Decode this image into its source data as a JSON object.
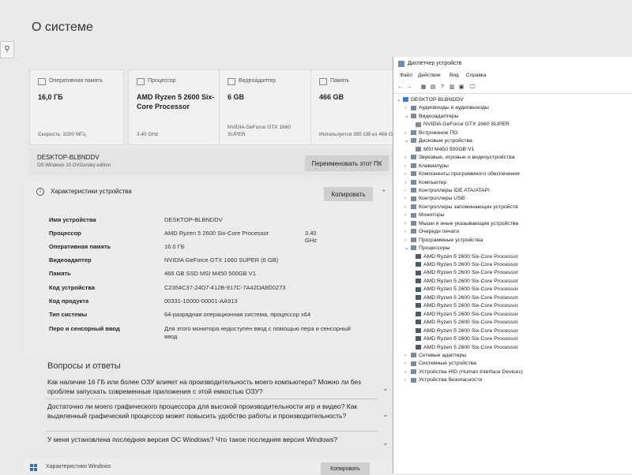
{
  "page": {
    "title": "О системе",
    "search_glyph": "⚲"
  },
  "cards": [
    {
      "label": "Оперативная память",
      "main": "16,0 ГБ",
      "sub": "Скорость: 3200 МГц"
    },
    {
      "label": "Процессор",
      "main": "AMD Ryzen 5 2600 Six-Core Processor",
      "sub": "3.40 GHz"
    },
    {
      "label": "Видеоадаптер",
      "main": "6 GB",
      "sub": "NVIDIA GeForce GTX 1660 SUPER"
    },
    {
      "label": "Память",
      "main": "466 GB",
      "sub": "Используется 395 GB из 466 GB"
    }
  ],
  "device": {
    "name": "DESKTOP-BLBNDDV",
    "os": "OS Windows 10 OVGorskiy edition",
    "rename_label": "Переименовать этот ПК"
  },
  "specs": {
    "title": "Характеристики устройства",
    "copy_label": "Копировать",
    "rows": [
      {
        "k": "Имя устройства",
        "v": "DESKTOP-BLBNDDV",
        "v2": ""
      },
      {
        "k": "Процессор",
        "v": "AMD Ryzen 5 2600 Six-Core Processor",
        "v2": "3.40 GHz"
      },
      {
        "k": "Оперативная память",
        "v": "16.0 ГБ",
        "v2": ""
      },
      {
        "k": "Видеоадаптер",
        "v": "NVIDIA GeForce GTX 1660 SUPER (6 GB)",
        "v2": ""
      },
      {
        "k": "Память",
        "v": "466 GB SSD MSI M450 500GB V1",
        "v2": ""
      },
      {
        "k": "Код устройства",
        "v": "C2354C37-24D7-412B-917C-7A42DA8D0273",
        "v2": ""
      },
      {
        "k": "Код продукта",
        "v": "00331-10000-00001-AA913",
        "v2": ""
      },
      {
        "k": "Тип системы",
        "v": "64-разрядная операционная система, процессор x64",
        "v2": ""
      },
      {
        "k": "Перо и сенсорный ввод",
        "v": "Для этого монитора недоступен ввод с помощью пера и сенсорный ввод",
        "v2": ""
      }
    ]
  },
  "faq": {
    "title": "Вопросы и ответы",
    "items": [
      "Как наличие 16 ГБ или более ОЗУ влияет на производительность моего компьютера? Можно ли без проблем запускать современные приложения с этой емкостью ОЗУ?",
      "Достаточно ли моего графического процессора для высокой производительности игр и видео? Как выделенный графический процессор может повысить удобство работы и производительность?",
      "У меня установлена последняя версия ОС Windows? Что такое последняя версия Windows?"
    ]
  },
  "bottom": {
    "label": "Характеристики Windows",
    "copy_label": "Копировать"
  },
  "device_manager": {
    "title": "Диспетчер устройств",
    "menu": [
      "Файл",
      "Действие",
      "Вид",
      "Справка"
    ],
    "toolbar": [
      "←",
      "→",
      "▦",
      "▤",
      "?",
      "▥",
      "▣",
      "🖵"
    ],
    "tree": [
      {
        "label": "DESKTOP-BLBNDDV",
        "level": 0,
        "exp": "⌄",
        "kind": "root"
      },
      {
        "label": "Аудиовходы и аудиовыходы",
        "level": 1,
        "exp": "›",
        "kind": ""
      },
      {
        "label": "Видеоадаптеры",
        "level": 1,
        "exp": "⌄",
        "kind": ""
      },
      {
        "label": "NVIDIA GeForce GTX 1660 SUPER",
        "level": 2,
        "exp": "",
        "kind": ""
      },
      {
        "label": "Встроенное ПО",
        "level": 1,
        "exp": "›",
        "kind": ""
      },
      {
        "label": "Дисковые устройства",
        "level": 1,
        "exp": "⌄",
        "kind": ""
      },
      {
        "label": "MSI M450 500GB V1",
        "level": 2,
        "exp": "",
        "kind": ""
      },
      {
        "label": "Звуковые, игровые и видеоустройства",
        "level": 1,
        "exp": "›",
        "kind": ""
      },
      {
        "label": "Клавиатуры",
        "level": 1,
        "exp": "›",
        "kind": ""
      },
      {
        "label": "Компоненты программного обеспечения",
        "level": 1,
        "exp": "›",
        "kind": ""
      },
      {
        "label": "Компьютер",
        "level": 1,
        "exp": "›",
        "kind": ""
      },
      {
        "label": "Контроллеры IDE ATA/ATAPI",
        "level": 1,
        "exp": "›",
        "kind": ""
      },
      {
        "label": "Контроллеры USB",
        "level": 1,
        "exp": "›",
        "kind": ""
      },
      {
        "label": "Контроллеры запоминающих устройств",
        "level": 1,
        "exp": "›",
        "kind": ""
      },
      {
        "label": "Мониторы",
        "level": 1,
        "exp": "›",
        "kind": ""
      },
      {
        "label": "Мыши и иные указывающие устройства",
        "level": 1,
        "exp": "›",
        "kind": ""
      },
      {
        "label": "Очереди печати",
        "level": 1,
        "exp": "›",
        "kind": ""
      },
      {
        "label": "Программные устройства",
        "level": 1,
        "exp": "›",
        "kind": ""
      },
      {
        "label": "Процессоры",
        "level": 1,
        "exp": "⌄",
        "kind": ""
      },
      {
        "label": "AMD Ryzen 5 2600 Six-Core Processor",
        "level": 2,
        "exp": "",
        "kind": "cpu"
      },
      {
        "label": "AMD Ryzen 5 2600 Six-Core Processor",
        "level": 2,
        "exp": "",
        "kind": "cpu"
      },
      {
        "label": "AMD Ryzen 5 2600 Six-Core Processor",
        "level": 2,
        "exp": "",
        "kind": "cpu"
      },
      {
        "label": "AMD Ryzen 5 2600 Six-Core Processor",
        "level": 2,
        "exp": "",
        "kind": "cpu"
      },
      {
        "label": "AMD Ryzen 5 2600 Six-Core Processor",
        "level": 2,
        "exp": "",
        "kind": "cpu"
      },
      {
        "label": "AMD Ryzen 5 2600 Six-Core Processor",
        "level": 2,
        "exp": "",
        "kind": "cpu"
      },
      {
        "label": "AMD Ryzen 5 2600 Six-Core Processor",
        "level": 2,
        "exp": "",
        "kind": "cpu"
      },
      {
        "label": "AMD Ryzen 5 2600 Six-Core Processor",
        "level": 2,
        "exp": "",
        "kind": "cpu"
      },
      {
        "label": "AMD Ryzen 5 2600 Six-Core Processor",
        "level": 2,
        "exp": "",
        "kind": "cpu"
      },
      {
        "label": "AMD Ryzen 5 2600 Six-Core Processor",
        "level": 2,
        "exp": "",
        "kind": "cpu"
      },
      {
        "label": "AMD Ryzen 5 2600 Six-Core Processor",
        "level": 2,
        "exp": "",
        "kind": "cpu"
      },
      {
        "label": "AMD Ryzen 5 2600 Six-Core Processor",
        "level": 2,
        "exp": "",
        "kind": "cpu"
      },
      {
        "label": "Сетевые адаптеры",
        "level": 1,
        "exp": "›",
        "kind": ""
      },
      {
        "label": "Системные устройства",
        "level": 1,
        "exp": "›",
        "kind": ""
      },
      {
        "label": "Устройства HID (Human Interface Devices)",
        "level": 1,
        "exp": "›",
        "kind": ""
      },
      {
        "label": "Устройства безопасности",
        "level": 1,
        "exp": "›",
        "kind": ""
      }
    ]
  }
}
